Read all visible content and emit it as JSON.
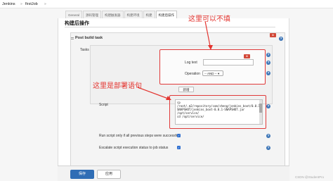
{
  "breadcrumb": {
    "root": "Jenkins",
    "separator": "»",
    "job": "firstJob"
  },
  "tabs": [
    {
      "label": "General",
      "active": false
    },
    {
      "label": "源码管理",
      "active": false
    },
    {
      "label": "构建触发器",
      "active": false
    },
    {
      "label": "构建环境",
      "active": false
    },
    {
      "label": "构建",
      "active": false
    },
    {
      "label": "构建后操作",
      "active": true
    }
  ],
  "section": {
    "title": "构建后操作"
  },
  "post_build_step": {
    "title": "Post build task",
    "delete_label": "x",
    "tasks_label": "Tasks",
    "task": {
      "delete_label": "x",
      "log_text_label": "Log text",
      "log_text_value": "",
      "operation_label": "Operation",
      "operation_value": "-- AND -- ▾"
    },
    "add_button_label": "新增",
    "script_label": "Script",
    "script_lines": [
      "cp",
      "/root/.m2/repository/com/zheng/jenkins_boot/0.0.1-",
      "SNAPSHOT/jenkins_boot-0.0.1-SNAPSHOT.jar",
      "/opt/service/",
      "cd /opt/service/"
    ],
    "run_only_label": "Run script only if all previous steps were successful",
    "escalate_label": "Escalate script execution status to job status",
    "help_label": "?"
  },
  "annotations": {
    "top_note": "这里可以不填",
    "script_note": "这里是部署语句",
    "color": "#e3342f"
  },
  "footer": {
    "save_label": "保存",
    "apply_label": "应用"
  },
  "watermark": "CSDN @StudentPro"
}
